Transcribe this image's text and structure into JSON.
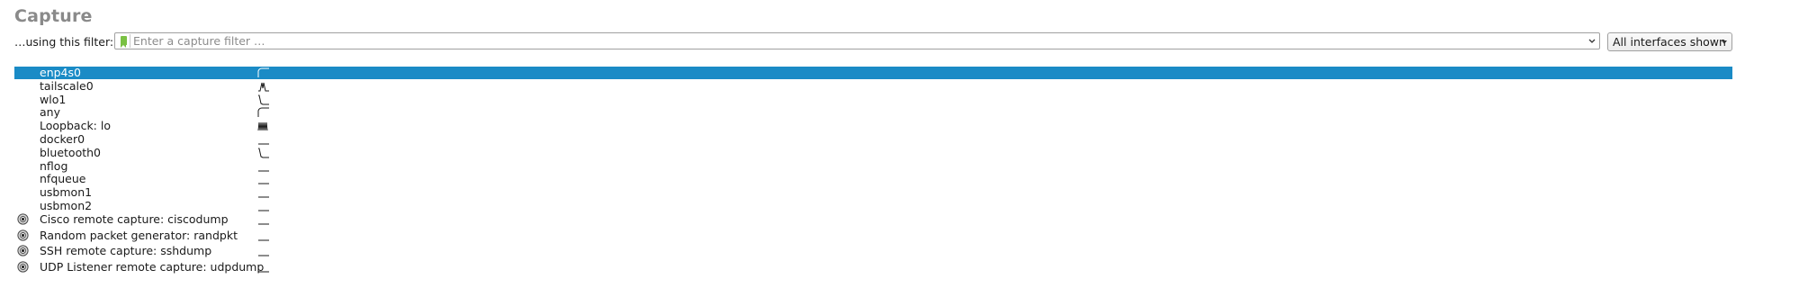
{
  "section": {
    "title": "Capture"
  },
  "filter": {
    "label": "…using this filter:",
    "value": "",
    "placeholder": "Enter a capture filter …",
    "bookmark_color": "#7ac143"
  },
  "interfaces_dropdown": {
    "selected": "All interfaces shown"
  },
  "colors": {
    "selection": "#1a8bc6",
    "title": "#8a8a8a"
  },
  "interfaces": [
    {
      "name": "enp4s0",
      "selected": true,
      "spark": "rise",
      "extcap": false
    },
    {
      "name": "tailscale0",
      "selected": false,
      "spark": "spike",
      "extcap": false
    },
    {
      "name": "wlo1",
      "selected": false,
      "spark": "fall",
      "extcap": false
    },
    {
      "name": "any",
      "selected": false,
      "spark": "rise",
      "extcap": false
    },
    {
      "name": "Loopback: lo",
      "selected": false,
      "spark": "multi",
      "extcap": false
    },
    {
      "name": "docker0",
      "selected": false,
      "spark": "flat",
      "extcap": false
    },
    {
      "name": "bluetooth0",
      "selected": false,
      "spark": "fall",
      "extcap": false
    },
    {
      "name": "nflog",
      "selected": false,
      "spark": "flat",
      "extcap": false
    },
    {
      "name": "nfqueue",
      "selected": false,
      "spark": "flat",
      "extcap": false
    },
    {
      "name": "usbmon1",
      "selected": false,
      "spark": "flat",
      "extcap": false
    },
    {
      "name": "usbmon2",
      "selected": false,
      "spark": "flat",
      "extcap": false
    },
    {
      "name": "Cisco remote capture: ciscodump",
      "selected": false,
      "spark": "flat",
      "extcap": true,
      "icon": "settings-gear-icon"
    },
    {
      "name": "Random packet generator: randpkt",
      "selected": false,
      "spark": "flat",
      "extcap": true,
      "icon": "settings-gear-icon"
    },
    {
      "name": "SSH remote capture: sshdump",
      "selected": false,
      "spark": "flat",
      "extcap": true,
      "icon": "settings-gear-icon"
    },
    {
      "name": "UDP Listener remote capture: udpdump",
      "selected": false,
      "spark": "flat",
      "extcap": true,
      "icon": "settings-gear-icon"
    }
  ]
}
